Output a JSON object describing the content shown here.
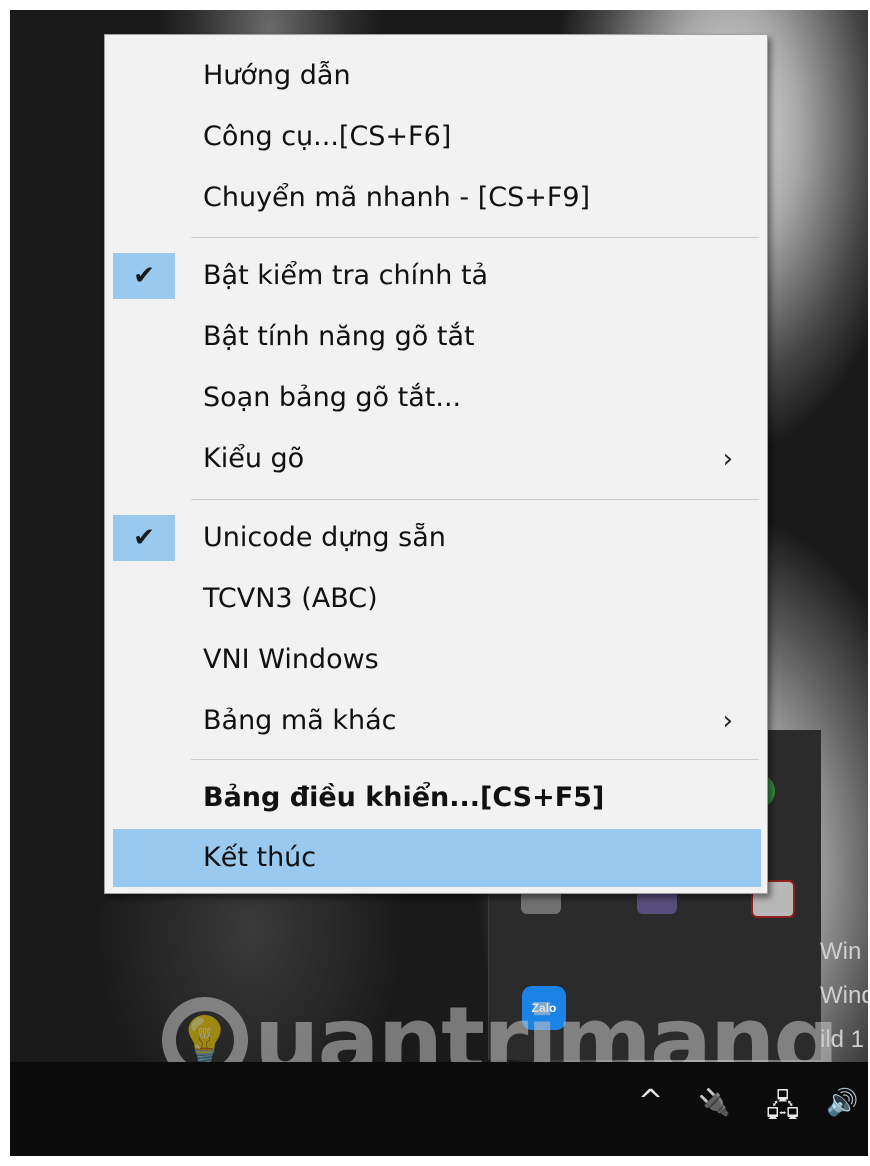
{
  "menu": {
    "items": [
      {
        "label": "Hướng dẫn",
        "checked": false,
        "submenu": false
      },
      {
        "label": "Công cụ...[CS+F6]",
        "checked": false,
        "submenu": false
      },
      {
        "label": "Chuyển mã nhanh - [CS+F9]",
        "checked": false,
        "submenu": false
      },
      {
        "label": "Bật kiểm tra chính tả",
        "checked": true,
        "submenu": false
      },
      {
        "label": "Bật tính năng gõ tắt",
        "checked": false,
        "submenu": false
      },
      {
        "label": "Soạn bảng gõ tắt...",
        "checked": false,
        "submenu": false
      },
      {
        "label": "Kiểu gõ",
        "checked": false,
        "submenu": true
      },
      {
        "label": "Unicode dựng sẵn",
        "checked": true,
        "submenu": false
      },
      {
        "label": "TCVN3 (ABC)",
        "checked": false,
        "submenu": false
      },
      {
        "label": "VNI Windows",
        "checked": false,
        "submenu": false
      },
      {
        "label": "Bảng mã khác",
        "checked": false,
        "submenu": true
      },
      {
        "label": "Bảng điều khiển...[CS+F5]",
        "checked": false,
        "submenu": false,
        "bold": true
      },
      {
        "label": "Kết thúc",
        "checked": false,
        "submenu": false,
        "highlighted": true
      }
    ],
    "check_glyph": "✔",
    "submenu_glyph": "›",
    "highlight_color": "#99c9ef"
  },
  "desktop": {
    "zalo_label": "Zalo",
    "activation_text_lines": [
      "Win",
      "Wind",
      "ild 1"
    ]
  },
  "taskbar": {
    "icons": [
      {
        "name": "show-hidden-icons",
        "glyph": "^"
      },
      {
        "name": "power-icon",
        "glyph": "🔌"
      },
      {
        "name": "network-icon",
        "glyph": "🖧"
      },
      {
        "name": "volume-icon",
        "glyph": "🔊"
      }
    ]
  },
  "watermark": {
    "text": "uantrimang"
  }
}
